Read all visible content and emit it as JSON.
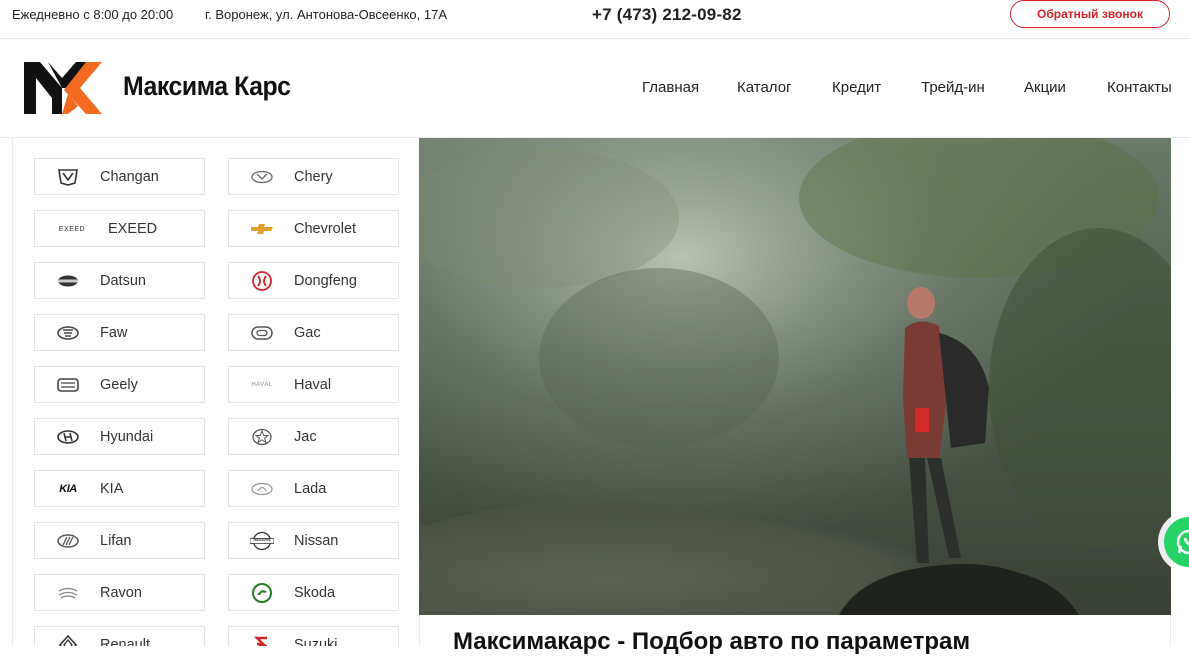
{
  "topbar": {
    "hours": "Ежедневно с 8:00 до 20:00",
    "address": "г. Воронеж, ул. Антонова-Овсеенко, 17А",
    "phone": "+7 (473) 212-09-82",
    "callback_label": "Обратный звонок"
  },
  "header": {
    "logo_text": "Максима Карс",
    "nav": [
      "Главная",
      "Каталог",
      "Кредит",
      "Трейд-ин",
      "Акции",
      "Контакты"
    ]
  },
  "brands": [
    {
      "name": "Changan",
      "icon": "changan-logo-icon"
    },
    {
      "name": "Chery",
      "icon": "chery-logo-icon"
    },
    {
      "name": "EXEED",
      "icon": "exeed-logo-icon"
    },
    {
      "name": "Chevrolet",
      "icon": "chevrolet-logo-icon"
    },
    {
      "name": "Datsun",
      "icon": "datsun-logo-icon"
    },
    {
      "name": "Dongfeng",
      "icon": "dongfeng-logo-icon"
    },
    {
      "name": "Faw",
      "icon": "faw-logo-icon"
    },
    {
      "name": "Gac",
      "icon": "gac-logo-icon"
    },
    {
      "name": "Geely",
      "icon": "geely-logo-icon"
    },
    {
      "name": "Haval",
      "icon": "haval-logo-icon"
    },
    {
      "name": "Hyundai",
      "icon": "hyundai-logo-icon"
    },
    {
      "name": "Jac",
      "icon": "jac-logo-icon"
    },
    {
      "name": "KIA",
      "icon": "kia-logo-icon"
    },
    {
      "name": "Lada",
      "icon": "lada-logo-icon"
    },
    {
      "name": "Lifan",
      "icon": "lifan-logo-icon"
    },
    {
      "name": "Nissan",
      "icon": "nissan-logo-icon"
    },
    {
      "name": "Ravon",
      "icon": "ravon-logo-icon"
    },
    {
      "name": "Skoda",
      "icon": "skoda-logo-icon"
    },
    {
      "name": "Renault",
      "icon": "renault-logo-icon"
    },
    {
      "name": "Suzuki",
      "icon": "suzuki-logo-icon"
    }
  ],
  "brand_icon_text": {
    "exeed": "EXEED",
    "haval": "HAVAL",
    "kia": "KIA",
    "nissan": "NISSAN"
  },
  "hero": {
    "title": "Максимакарс - Подбор авто по параметрам"
  },
  "colors": {
    "accent": "#d8222a",
    "logo_orange": "#f26b21",
    "whatsapp": "#25d366"
  }
}
